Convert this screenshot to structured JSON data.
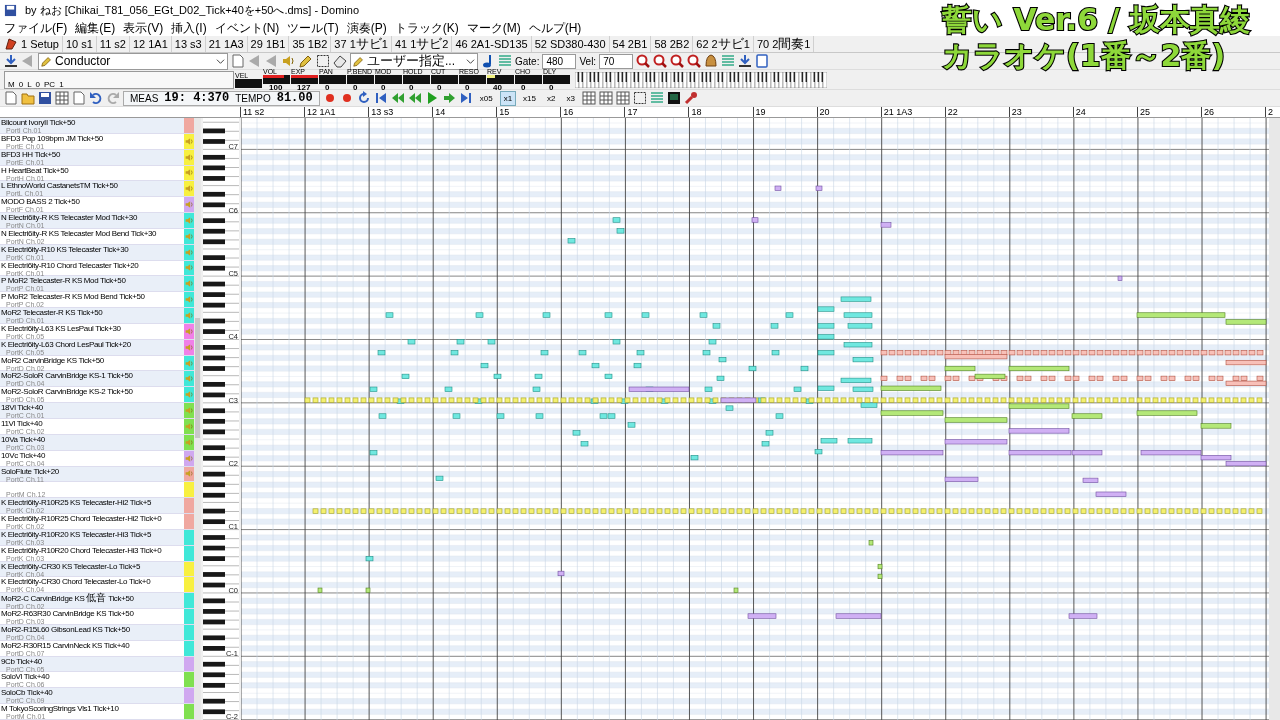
{
  "window": {
    "title": "by ねお [Chikai_T81_056_EGt_D02_Tick+40を+50へ.dms] - Domino"
  },
  "menu": [
    "ファイル(F)",
    "編集(E)",
    "表示(V)",
    "挿入(I)",
    "イベント(N)",
    "ツール(T)",
    "演奏(P)",
    "トラック(K)",
    "マーク(M)",
    "ヘルプ(H)"
  ],
  "markers": [
    "1 Setup",
    "10 s1",
    "11 s2",
    "12 1A1",
    "13 s3",
    "21 1A3",
    "29 1B1",
    "35 1B2",
    "37 1サビ1",
    "41 1サビ2",
    "46 2A1-SD135",
    "52 SD380-430",
    "54 2B1",
    "58 2B2",
    "62 2サビ1",
    "70 2間奏1"
  ],
  "toolbar": {
    "track_select": "Conductor",
    "tool_select": "ユーザー指定...",
    "gate_label": "Gate:",
    "gate": "480",
    "vel_label": "Vel:",
    "vel": "70"
  },
  "status": {
    "m_label": "M",
    "m": "0",
    "l_label": "L",
    "l": "0",
    "pc_label": "PC",
    "pc": "1"
  },
  "meters": [
    {
      "label": "VEL"
    },
    {
      "label": "VOL",
      "value": "100",
      "level": 0.79,
      "color": "#e02020"
    },
    {
      "label": "EXP",
      "value": "127",
      "level": 1,
      "color": "#e02020"
    },
    {
      "label": "PAN",
      "value": "0"
    },
    {
      "label": "P.BEND",
      "value": "0"
    },
    {
      "label": "MOD",
      "value": "0"
    },
    {
      "label": "HOLD",
      "value": "0"
    },
    {
      "label": "CUT",
      "value": "0"
    },
    {
      "label": "RESO",
      "value": "0"
    },
    {
      "label": "REV",
      "value": "40",
      "level": 0.31,
      "color": "#f0f080"
    },
    {
      "label": "CHO",
      "value": "0"
    },
    {
      "label": "DLY",
      "value": "0"
    }
  ],
  "transport": {
    "meas_label": "MEAS",
    "meas": "19: 4:370",
    "tempo_label": "TEMPO",
    "tempo": "81.00",
    "speeds": [
      {
        "label": "x05",
        "selected": false
      },
      {
        "label": "x1",
        "selected": true
      },
      {
        "label": "x15",
        "selected": false
      },
      {
        "label": "x2",
        "selected": false
      },
      {
        "label": "x3",
        "selected": false
      }
    ]
  },
  "ruler": [
    "11 s2",
    "12 1A1",
    "13 s3",
    "14",
    "15",
    "16",
    "17",
    "18",
    "19",
    "20",
    "21 1A3",
    "22",
    "23",
    "24",
    "25",
    "26",
    "2"
  ],
  "tracks": [
    {
      "name": "Bllcount IvoryII Tick+50",
      "port": "PortI Ch.01",
      "color": "#f0a8a0",
      "speaker": false
    },
    {
      "name": "BFD3 Pop 109bpm JM Tick+50",
      "port": "PortE Ch.01",
      "color": "#f8f040",
      "speaker": true
    },
    {
      "name": "BFD3 HH Tick+50",
      "port": "PortE Ch.01",
      "color": "#f8f040",
      "speaker": true
    },
    {
      "name": "H HeartBeat Tick+50",
      "port": "PortH Ch.01",
      "color": "#f8f040",
      "speaker": true
    },
    {
      "name": "L EthnoWorld CastanetsTM Tick+50",
      "port": "PortL Ch.01",
      "color": "#f8f040",
      "speaker": true
    },
    {
      "name": "MODO BASS 2 Tick+50",
      "port": "PortF Ch.01",
      "color": "#d0a8f0",
      "speaker": true
    },
    {
      "name": "N Electri6ity-R KS Telecaster Mod Tick+30",
      "port": "PortN Ch.01",
      "color": "#40e8d8",
      "speaker": true
    },
    {
      "name": "N Electri6ity-R KS Telecaster Mod Bend Tick+30",
      "port": "PortN Ch.02",
      "color": "#40e8d8",
      "speaker": true
    },
    {
      "name": "K Electri6ity-R10 KS Telecaster Tick+30",
      "port": "PortK Ch.01",
      "color": "#40e8d8",
      "speaker": true
    },
    {
      "name": "K Electri6ity-R10 Chord Telecaster Tick+20",
      "port": "PortK Ch.01",
      "color": "#40e8d8",
      "speaker": true
    },
    {
      "name": "P MoR2 Telecaster-R KS Mod Tick+50",
      "port": "PortP Ch.01",
      "color": "#40e8d8",
      "speaker": true
    },
    {
      "name": "P MoR2 Telecaster-R KS Mod Bend Tick+50",
      "port": "PortP Ch.02",
      "color": "#40e8d8",
      "speaker": true
    },
    {
      "name": "MoR2 Telecaster-R KS Tick+50",
      "port": "PortD Ch.01",
      "color": "#40e8d8",
      "speaker": true
    },
    {
      "name": "K Electri6ity-L63 KS LesPaul Tick+30",
      "port": "PortK Ch.05",
      "color": "#f080e8",
      "speaker": true
    },
    {
      "name": "K Electri6ity-L63 Chord LesPaul Tick+20",
      "port": "PortK Ch.05",
      "color": "#f080e8",
      "speaker": true
    },
    {
      "name": "MoR2 CarvinBridge KS Tick+50",
      "port": "PortD Ch.02",
      "color": "#40e8d8",
      "speaker": true
    },
    {
      "name": "MoR2-SoloR CarvinBridge KS-1 Tick+50",
      "port": "PortD Ch.04",
      "color": "#40e8d8",
      "speaker": true
    },
    {
      "name": "MoR2-SoloR CarvinBridge KS-2 Tick+50",
      "port": "PortD Ch.05",
      "color": "#40e8d8",
      "speaker": true
    },
    {
      "name": "18Vl Tick+40",
      "port": "PortC Ch.01",
      "color": "#80e050",
      "speaker": true
    },
    {
      "name": "11Vl Tick+40",
      "port": "PortC Ch.02",
      "color": "#80e050",
      "speaker": true
    },
    {
      "name": "10Va Tick+40",
      "port": "PortC Ch.03",
      "color": "#80e050",
      "speaker": true
    },
    {
      "name": "10Vc Tick+40",
      "port": "PortC Ch.04",
      "color": "#d0a8f0",
      "speaker": true
    },
    {
      "name": "SoloFlute Tick+20",
      "port": "PortC Ch.11",
      "color": "#f0a8a0",
      "speaker": true
    },
    {
      "port": "PortM Ch.12",
      "color": "#f8f040",
      "speaker": false
    },
    {
      "name": "K Electri6ity-R10R25 KS Telecaster-Hi2 Tick+5",
      "port": "PortK Ch.02",
      "color": "#f0a8a0",
      "speaker": false
    },
    {
      "name": "K Electri6ity-R10R25 Chord Telecaster-Hi2 Tick+0",
      "port": "PortK Ch.02",
      "color": "#f0a8a0",
      "speaker": false
    },
    {
      "name": "K Electri6ity-R10R20 KS Telecaster-Hi3 Tick+5",
      "port": "PortK Ch.03",
      "color": "#40e8d8",
      "speaker": false
    },
    {
      "name": "K Electri6ity-R10R20 Chord Telecaster-Hi3 Tick+0",
      "port": "PortK Ch.03",
      "color": "#40e8d8",
      "speaker": false
    },
    {
      "name": "K Electri6ity-CR30 KS Telecaster-Lo Tick+5",
      "port": "PortK Ch.04",
      "color": "#f8f040",
      "speaker": false
    },
    {
      "name": "K Electri6ity-CR30 Chord Telecaster-Lo Tick+0",
      "port": "PortK Ch.04",
      "color": "#f8f040",
      "speaker": false
    },
    {
      "name": "MoR2-C CarvinBridge KS 低音 Tick+50",
      "port": "PortD Ch.02",
      "color": "#40e8d8",
      "speaker": false
    },
    {
      "name": "MoR2-R63R30 CarvinBridge KS Tick+50",
      "port": "PortD Ch.03",
      "color": "#40e8d8",
      "speaker": false
    },
    {
      "name": "MoR2-R15L60 GibsonLead KS Tick+50",
      "port": "PortD Ch.04",
      "color": "#40e8d8",
      "speaker": false
    },
    {
      "name": "MoR2-R30R15 CarvinNeck KS Tick+40",
      "port": "PortD Ch.07",
      "color": "#40e8d8",
      "speaker": false
    },
    {
      "name": "9Cb Tick+40",
      "port": "PortC Ch.05",
      "color": "#d0a8f0",
      "speaker": false
    },
    {
      "name": "SoloVl Tick+40",
      "port": "PortC Ch.06",
      "color": "#80e050",
      "speaker": false
    },
    {
      "name": "SoloCb Tick+40",
      "port": "PortC Ch.09",
      "color": "#d0a8f0",
      "speaker": false
    },
    {
      "name": "M TokyoScoringStrings Vls1 Tick+10",
      "port": "PortM Ch.01",
      "color": "#80e050",
      "speaker": false
    }
  ],
  "octaves": [
    "C7",
    "C6",
    "C5",
    "C4",
    "C3",
    "C2",
    "C1",
    "C0",
    "C-1",
    "C-2"
  ],
  "overlay": {
    "line_1": "誓い Ver.6 / 坂本真綾",
    "line_2": "カラオケ(1番～2番)"
  }
}
